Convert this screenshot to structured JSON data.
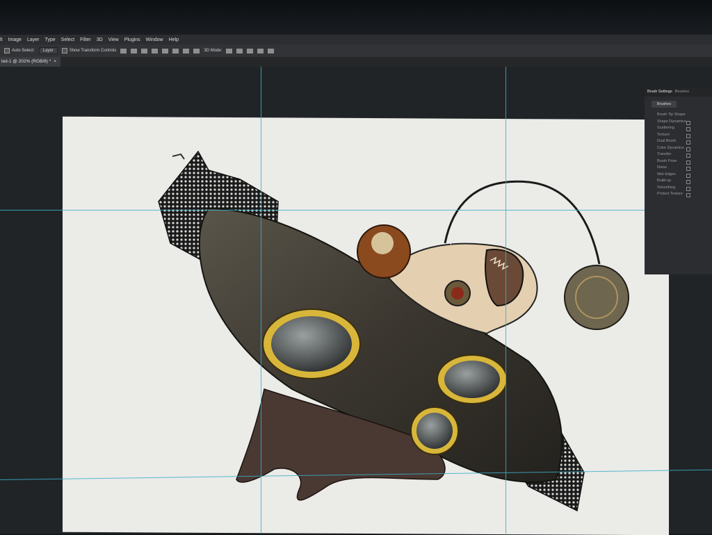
{
  "menu": [
    "lt",
    "Image",
    "Layer",
    "Type",
    "Select",
    "Filter",
    "3D",
    "View",
    "Plugins",
    "Window",
    "Help"
  ],
  "options": {
    "auto_select_label": "Auto-Select:",
    "layer_value": "Layer",
    "transform_label": "Show Transform Controls",
    "mode_label": "3D Mode:"
  },
  "document_tab": {
    "title": "led-1 @ 202% (RGB/8) *",
    "close": "×"
  },
  "panel": {
    "tabs": [
      "Brush Settings",
      "Brushes"
    ],
    "brushes_button": "Brushes",
    "options": [
      "Brush Tip Shape",
      "Shape Dynamics",
      "Scattering",
      "Texture",
      "Dual Brush",
      "Color Dynamics",
      "Transfer",
      "Brush Pose",
      "Noise",
      "Wet Edges",
      "Build-up",
      "Smoothing",
      "Protect Texture"
    ]
  },
  "colors": {
    "accent_guide": "#3ab0c8",
    "canvas": "#ebebe8",
    "gold": "#d8b63a"
  }
}
